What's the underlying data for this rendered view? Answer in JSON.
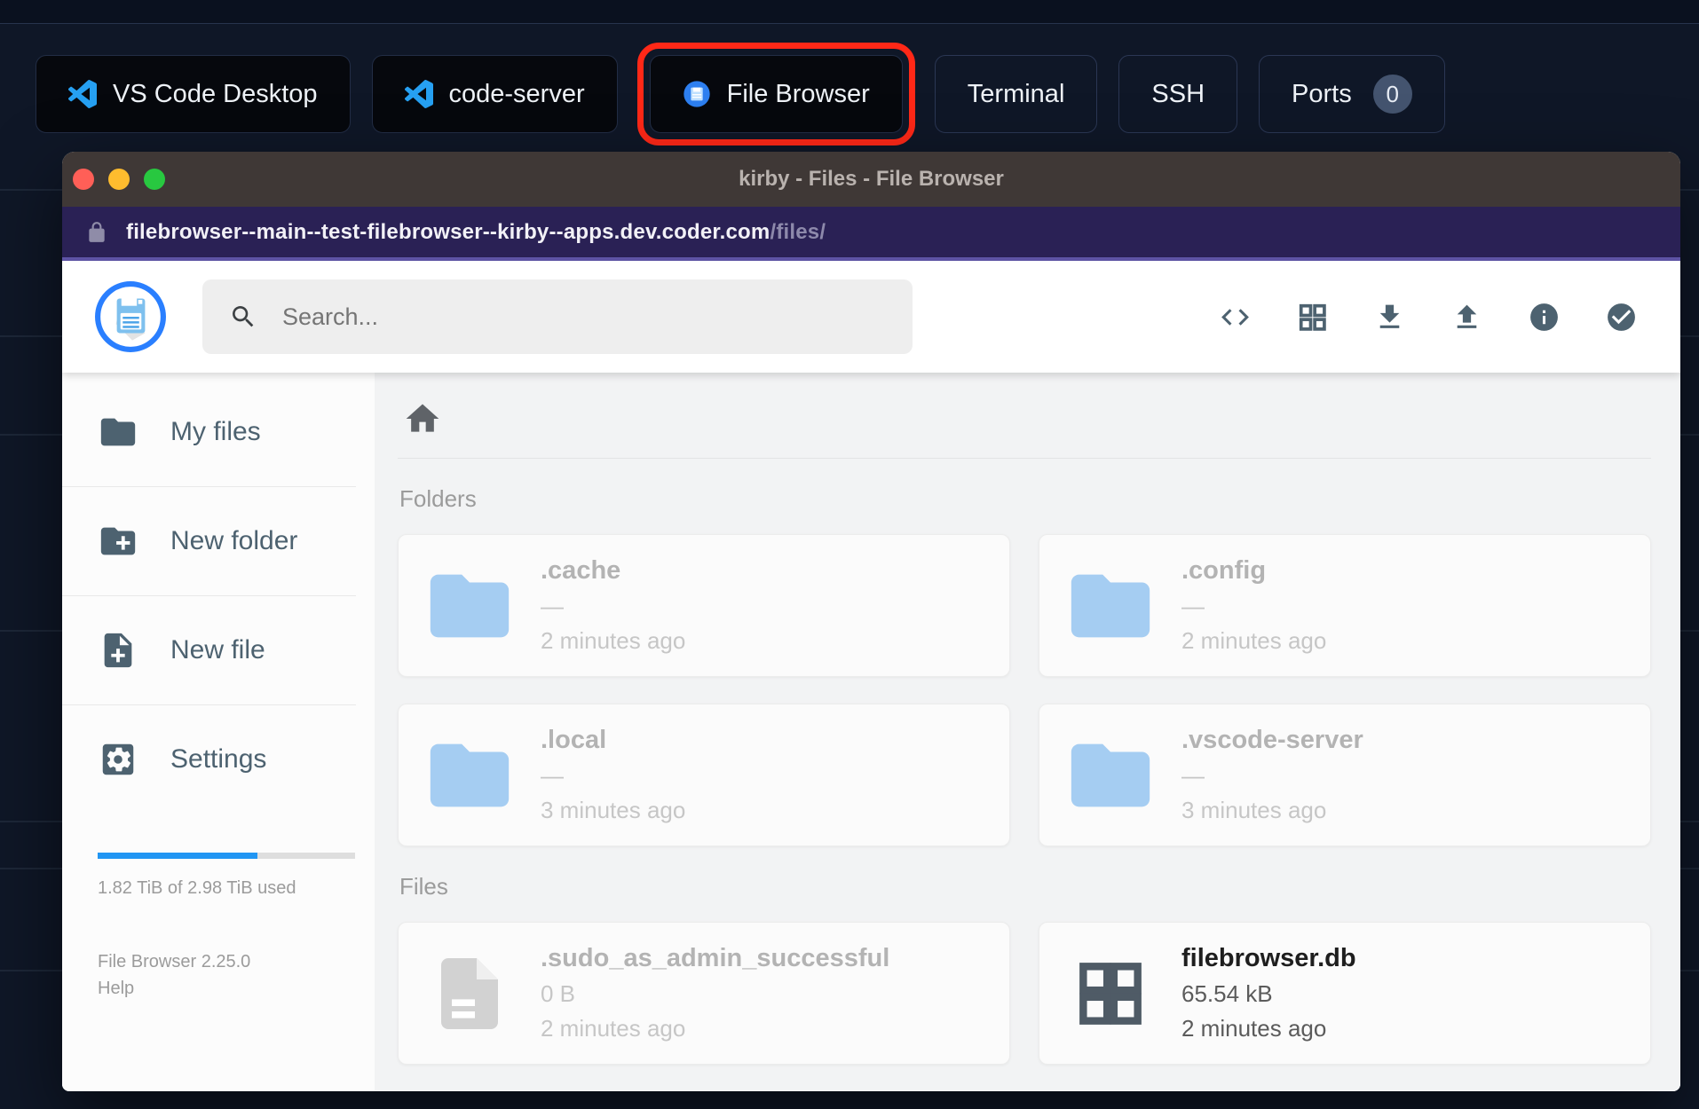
{
  "toolbar": {
    "buttons": [
      {
        "label": "VS Code Desktop"
      },
      {
        "label": "code-server"
      },
      {
        "label": "File Browser"
      },
      {
        "label": "Terminal"
      },
      {
        "label": "SSH"
      },
      {
        "label": "Ports",
        "badge": "0"
      }
    ]
  },
  "window": {
    "title": "kirby - Files - File Browser",
    "url_domain": "filebrowser--main--test-filebrowser--kirby--apps.dev.coder.com",
    "url_path": "/files/"
  },
  "app": {
    "search_placeholder": "Search...",
    "header_icons": [
      "code",
      "grid",
      "download",
      "upload",
      "info",
      "check"
    ],
    "sidebar": {
      "items": [
        {
          "label": "My files"
        },
        {
          "label": "New folder"
        },
        {
          "label": "New file"
        },
        {
          "label": "Settings"
        }
      ],
      "storage_percent": 62,
      "storage_text": "1.82 TiB of 2.98 TiB used",
      "version": "File Browser 2.25.0",
      "help": "Help"
    }
  },
  "content": {
    "folders_label": "Folders",
    "files_label": "Files",
    "folders": [
      {
        "name": ".cache",
        "size": "—",
        "time": "2 minutes ago"
      },
      {
        "name": ".config",
        "size": "—",
        "time": "2 minutes ago"
      },
      {
        "name": ".local",
        "size": "—",
        "time": "3 minutes ago"
      },
      {
        "name": ".vscode-server",
        "size": "—",
        "time": "3 minutes ago"
      }
    ],
    "files": [
      {
        "name": ".sudo_as_admin_successful",
        "size": "0 B",
        "time": "2 minutes ago"
      },
      {
        "name": "filebrowser.db",
        "size": "65.54 kB",
        "time": "2 minutes ago"
      }
    ]
  },
  "colors": {
    "accent_blue": "#2196f3",
    "folder_blue": "#a5cdf2",
    "annotation_red": "#ff2817",
    "icon_slate": "#4d6270",
    "url_bar": "#2a2155",
    "titlebar": "#3f3836"
  }
}
